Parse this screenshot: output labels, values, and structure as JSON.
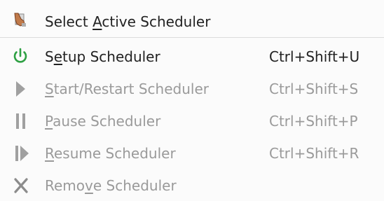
{
  "menu": {
    "items": [
      {
        "icon": "select-scheduler-icon",
        "label_pre": "Select ",
        "mnemonic": "A",
        "label_post": "ctive Scheduler",
        "shortcut": "",
        "enabled": true
      },
      {
        "icon": "power-icon",
        "label_pre": "S",
        "mnemonic": "e",
        "label_post": "tup Scheduler",
        "shortcut": "Ctrl+Shift+U",
        "enabled": true
      },
      {
        "icon": "play-icon",
        "label_pre": "",
        "mnemonic": "S",
        "label_post": "tart/Restart Scheduler",
        "shortcut": "Ctrl+Shift+S",
        "enabled": false
      },
      {
        "icon": "pause-icon",
        "label_pre": "",
        "mnemonic": "P",
        "label_post": "ause Scheduler",
        "shortcut": "Ctrl+Shift+P",
        "enabled": false
      },
      {
        "icon": "resume-icon",
        "label_pre": "",
        "mnemonic": "R",
        "label_post": "esume Scheduler",
        "shortcut": "Ctrl+Shift+R",
        "enabled": false
      },
      {
        "icon": "close-x-icon",
        "label_pre": "Remo",
        "mnemonic": "v",
        "label_post": "e Scheduler",
        "shortcut": "",
        "enabled": false
      }
    ]
  },
  "colors": {
    "text": "#222222",
    "disabled_text": "#9a9a9a",
    "power_icon": "#2ea043",
    "disabled_icon": "#a0a0a0"
  }
}
